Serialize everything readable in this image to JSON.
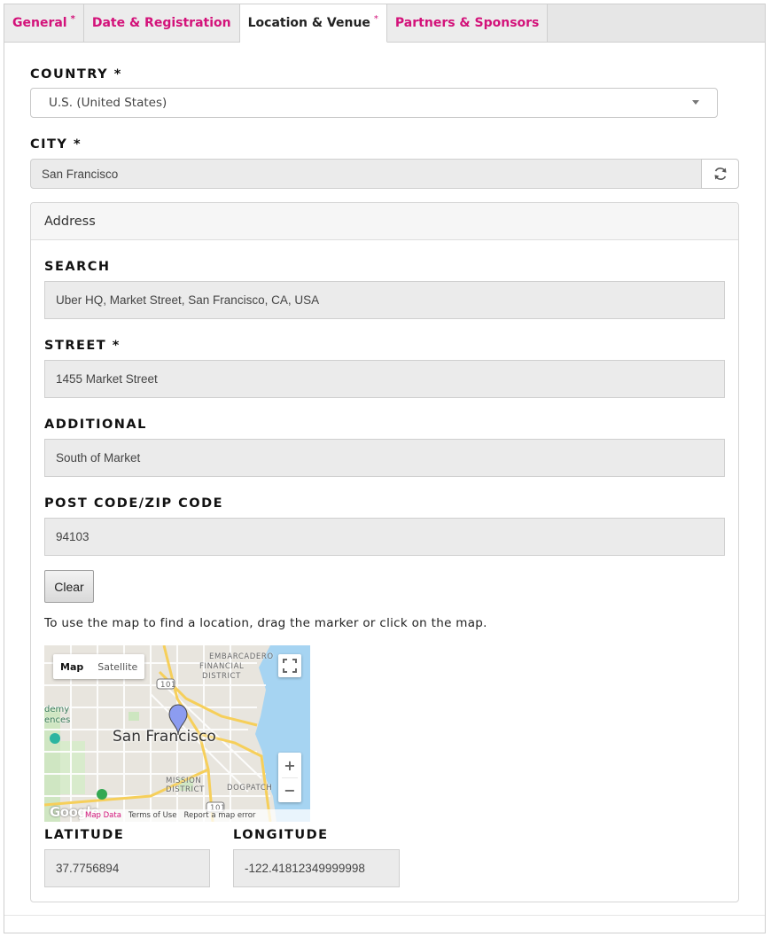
{
  "tabs": [
    {
      "label": "General",
      "required": "*",
      "active": false
    },
    {
      "label": "Date & Registration",
      "required": "",
      "active": false
    },
    {
      "label": "Location & Venue",
      "required": "*",
      "active": true
    },
    {
      "label": "Partners & Sponsors",
      "required": "",
      "active": false
    }
  ],
  "country": {
    "label": "COUNTRY *",
    "value": "U.S. (United States)"
  },
  "city": {
    "label": "CITY *",
    "value": "San Francisco",
    "refresh_icon": "refresh-icon"
  },
  "address": {
    "title": "Address",
    "search": {
      "label": "SEARCH",
      "value": "Uber HQ, Market Street, San Francisco, CA, USA"
    },
    "street": {
      "label": "STREET *",
      "value": "1455 Market Street"
    },
    "additional": {
      "label": "ADDITIONAL",
      "value": "South of Market"
    },
    "postcode": {
      "label": "POST CODE/ZIP CODE",
      "value": "94103"
    },
    "clear_label": "Clear",
    "hint": "To use the map to find a location, drag the marker or click on the map.",
    "map": {
      "type_map": "Map",
      "type_satellite": "Satellite",
      "city_label": "San Francisco",
      "district_embarcadero": "EMBARCADERO",
      "district_financial": "FINANCIAL",
      "district_district": "DISTRICT",
      "district_mission": "MISSION",
      "district_mission2": "DISTRICT",
      "district_dogpatch": "DOGPATCH",
      "academy_1": "demy",
      "academy_2": "ences",
      "highway_top": "101",
      "highway_bottom": "101",
      "zoom_in": "+",
      "zoom_out": "−",
      "logo": "Google",
      "footer_data": "Map Data",
      "footer_terms": "Terms of Use",
      "footer_report": "Report a map error"
    },
    "latitude": {
      "label": "LATITUDE",
      "value": "37.7756894"
    },
    "longitude": {
      "label": "LONGITUDE",
      "value": "-122.41812349999998"
    }
  },
  "colors": {
    "accent": "#d3127a",
    "marker": "#8c9cf0",
    "water": "#a6d4f2"
  }
}
